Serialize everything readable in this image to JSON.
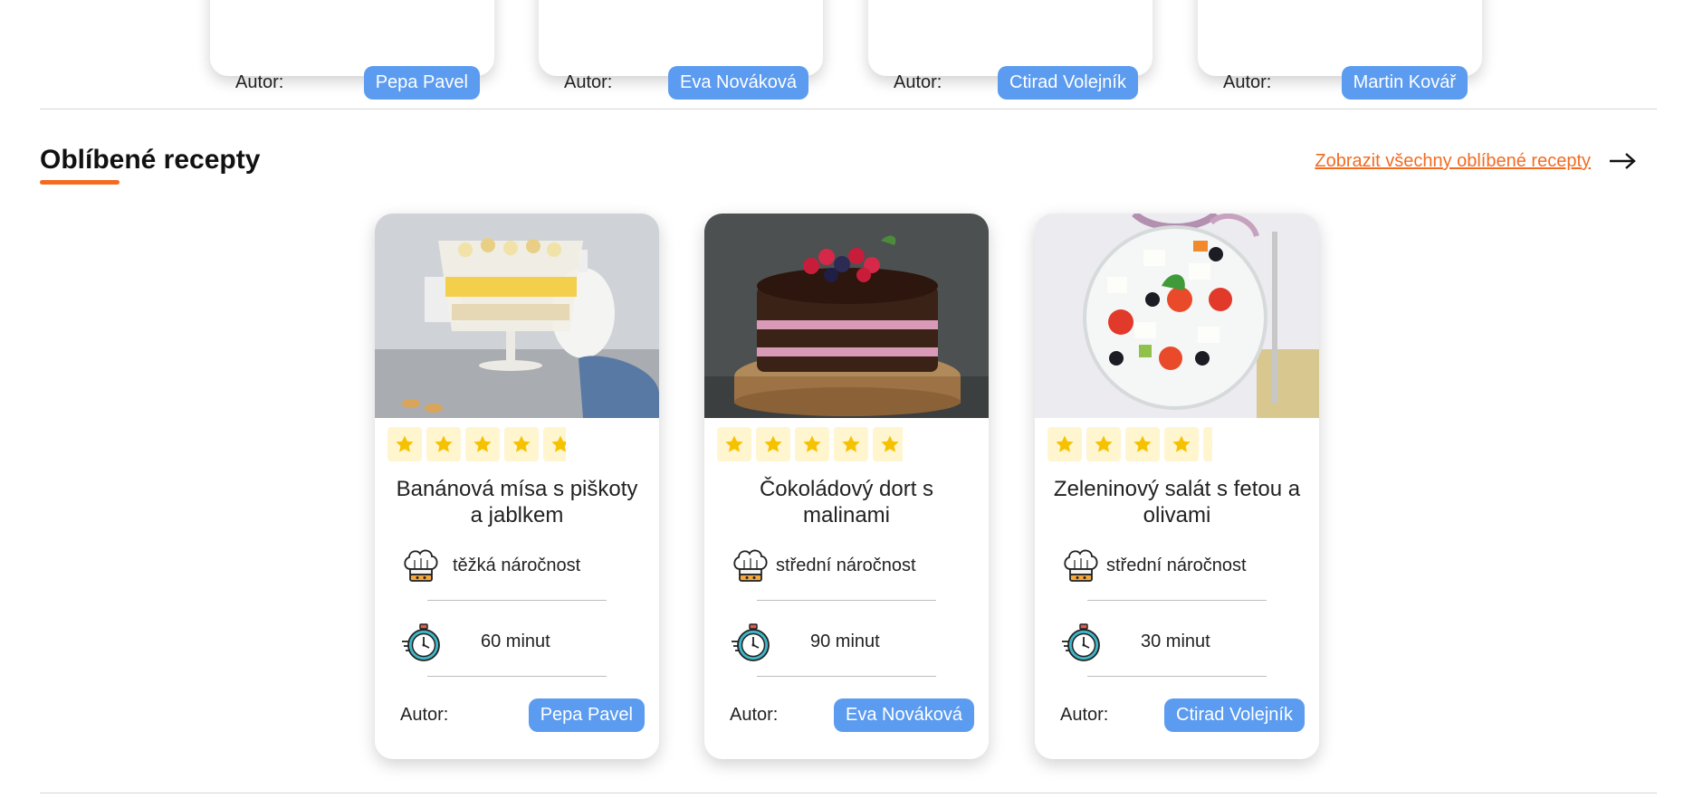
{
  "top_cards": [
    {
      "author_label": "Autor:",
      "author": "Pepa Pavel"
    },
    {
      "author_label": "Autor:",
      "author": "Eva Nováková"
    },
    {
      "author_label": "Autor:",
      "author": "Ctirad Volejník"
    },
    {
      "author_label": "Autor:",
      "author": "Martin Kovář"
    }
  ],
  "favorites": {
    "title": "Oblíbené recepty",
    "view_all": "Zobrazit všechny oblíbené recepty",
    "arrow_icon": "arrow-right-icon",
    "accent_color": "#f36b21",
    "badge_color": "#5b9bf0"
  },
  "recipes": [
    {
      "title": "Banánová mísa s piškoty a jablkem",
      "image": "banana-pudding-trifle-image",
      "rating": 4.5,
      "difficulty": "těžká náročnost",
      "time": "60 minut",
      "author_label": "Autor:",
      "author": "Pepa Pavel"
    },
    {
      "title": "Čokoládový dort s malinami",
      "image": "chocolate-raspberry-cake-image",
      "rating": 5,
      "difficulty": "střední náročnost",
      "time": "90 minut",
      "author_label": "Autor:",
      "author": "Eva Nováková"
    },
    {
      "title": "Zeleninový salát s fetou a olivami",
      "image": "greek-salad-image",
      "rating": 4,
      "difficulty": "střední náročnost",
      "time": "30 minut",
      "author_label": "Autor:",
      "author": "Ctirad Volejník"
    }
  ]
}
